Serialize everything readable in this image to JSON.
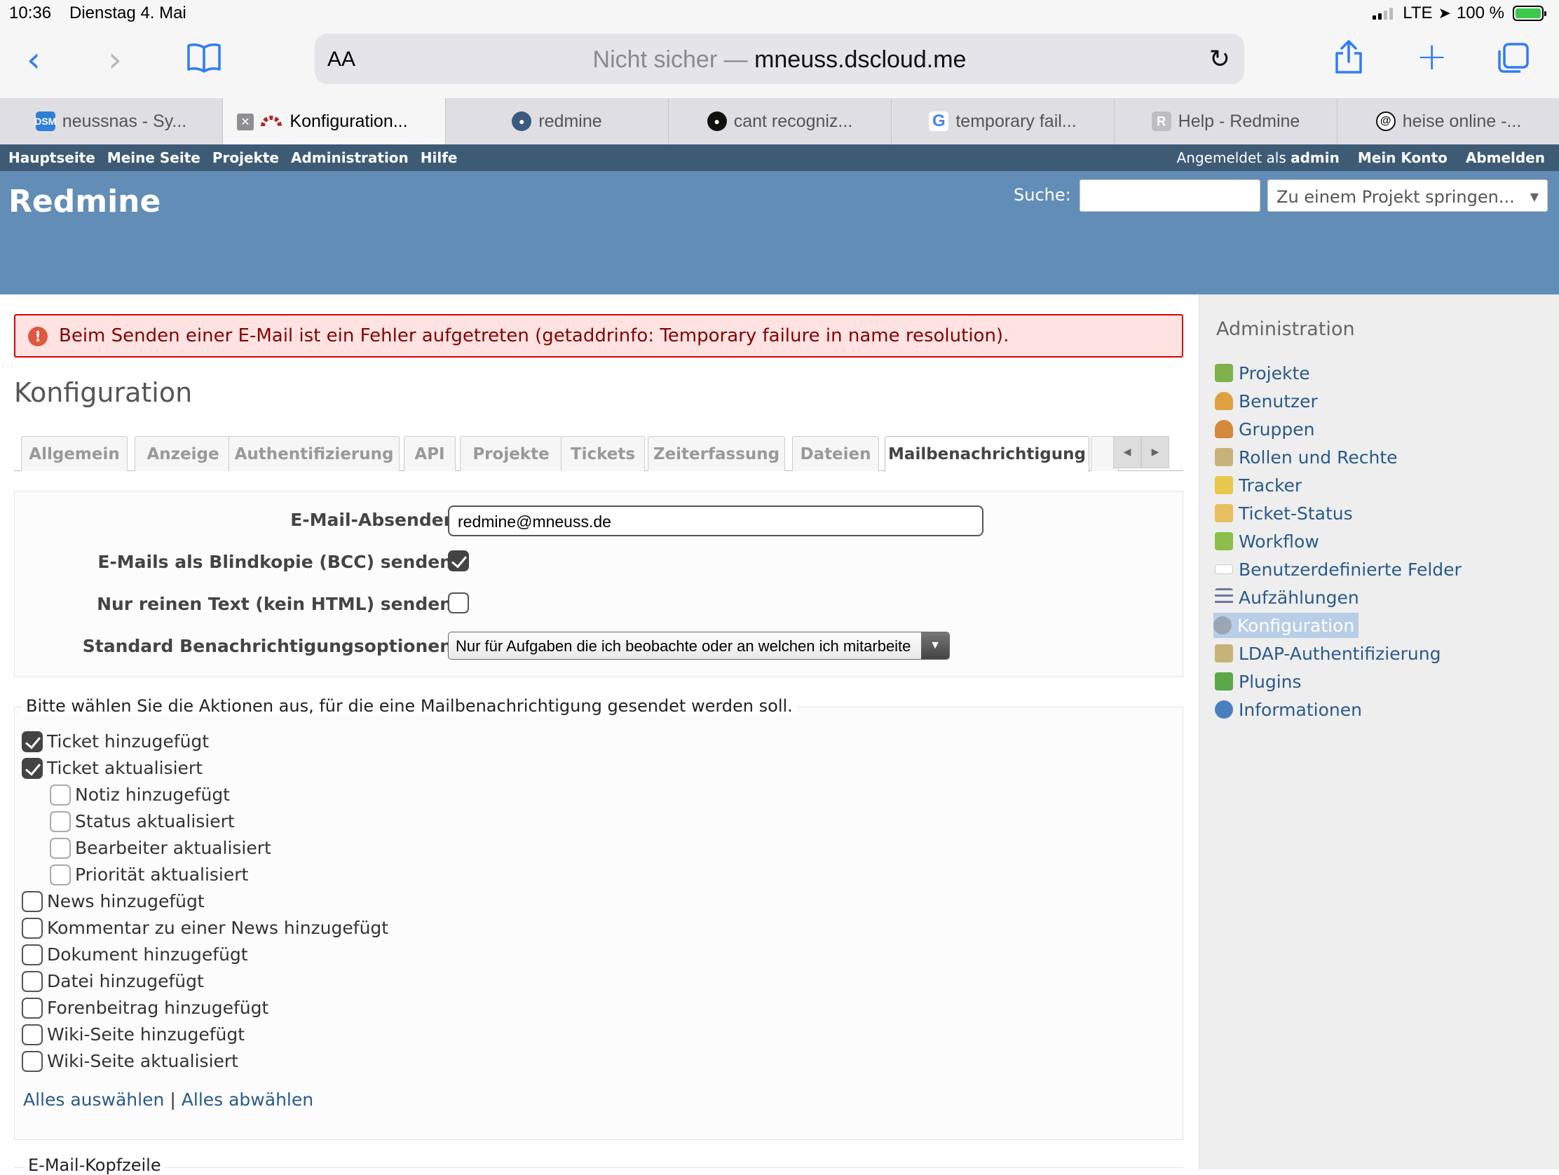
{
  "status": {
    "time": "10:36",
    "date": "Dienstag 4. Mai",
    "network": "LTE",
    "battery": "100 %"
  },
  "safari": {
    "aa": "AA",
    "not_secure": "Nicht sicher —",
    "host": "mneuss.dscloud.me",
    "tabs": [
      {
        "label": "neussnas - Sy...",
        "icon": "dsm-icon",
        "fav_text": "DSM",
        "fav_color": "#2f7fd6"
      },
      {
        "label": "Konfiguration...",
        "icon": "redmine-icon",
        "active": true
      },
      {
        "label": "redmine",
        "icon": "docker-icon"
      },
      {
        "label": "cant recogniz...",
        "icon": "github-icon"
      },
      {
        "label": "temporary fail...",
        "icon": "google-icon"
      },
      {
        "label": "Help - Redmine",
        "icon": "r-letter-icon",
        "fav_text": "R",
        "fav_color": "#bdbdc2"
      },
      {
        "label": "heise online -...",
        "icon": "heise-icon"
      }
    ]
  },
  "topmenu": {
    "items": [
      "Hauptseite",
      "Meine Seite",
      "Projekte",
      "Administration",
      "Hilfe"
    ],
    "logged_prefix": "Angemeldet als",
    "user": "admin",
    "account": "Mein Konto",
    "logout": "Abmelden"
  },
  "header": {
    "title": "Redmine",
    "search_label": "Suche:",
    "jump_placeholder": "Zu einem Projekt springen..."
  },
  "flash": {
    "message": "Beim Senden einer E-Mail ist ein Fehler aufgetreten (getaddrinfo: Temporary failure in name resolution)."
  },
  "page_title": "Konfiguration",
  "config_tabs": [
    "Allgemein",
    "Anzeige",
    "Authentifizierung",
    "API",
    "Projekte",
    "Tickets",
    "Zeiterfassung",
    "Dateien",
    "Mailbenachrichtigung"
  ],
  "selected_tab": "Mailbenachrichtigung",
  "mail_settings": {
    "sender_label": "E-Mail-Absender",
    "sender_value": "redmine@mneuss.de",
    "bcc_label": "E-Mails als Blindkopie (BCC) senden",
    "bcc_checked": true,
    "plain_label": "Nur reinen Text (kein HTML) senden",
    "plain_checked": false,
    "default_label": "Standard Benachrichtigungsoptionen",
    "default_value": "Nur für Aufgaben die ich beobachte oder an welchen ich mitarbeite"
  },
  "actions": {
    "legend": "Bitte wählen Sie die Aktionen aus, für die eine Mailbenachrichtigung gesendet werden soll.",
    "items": [
      {
        "label": "Ticket hinzugefügt",
        "checked": true,
        "indent": false
      },
      {
        "label": "Ticket aktualisiert",
        "checked": true,
        "indent": false
      },
      {
        "label": "Notiz hinzugefügt",
        "checked": false,
        "indent": true
      },
      {
        "label": "Status aktualisiert",
        "checked": false,
        "indent": true
      },
      {
        "label": "Bearbeiter aktualisiert",
        "checked": false,
        "indent": true
      },
      {
        "label": "Priorität aktualisiert",
        "checked": false,
        "indent": true
      },
      {
        "label": "News hinzugefügt",
        "checked": false,
        "indent": false
      },
      {
        "label": "Kommentar zu einer News hinzugefügt",
        "checked": false,
        "indent": false
      },
      {
        "label": "Dokument hinzugefügt",
        "checked": false,
        "indent": false
      },
      {
        "label": "Datei hinzugefügt",
        "checked": false,
        "indent": false
      },
      {
        "label": "Forenbeitrag hinzugefügt",
        "checked": false,
        "indent": false
      },
      {
        "label": "Wiki-Seite hinzugefügt",
        "checked": false,
        "indent": false
      },
      {
        "label": "Wiki-Seite aktualisiert",
        "checked": false,
        "indent": false
      }
    ],
    "select_all": "Alles auswählen",
    "separator": "|",
    "deselect_all": "Alles abwählen"
  },
  "next_section": "E-Mail-Kopfzeile",
  "sidebar": {
    "title": "Administration",
    "items": [
      {
        "label": "Projekte",
        "icon": "projects-icon",
        "color": "#7fb24a"
      },
      {
        "label": "Benutzer",
        "icon": "user-icon",
        "color": "#e0a040"
      },
      {
        "label": "Gruppen",
        "icon": "group-icon",
        "color": "#d48a3a"
      },
      {
        "label": "Rollen und Rechte",
        "icon": "roles-icon",
        "color": "#c9b27a"
      },
      {
        "label": "Tracker",
        "icon": "tracker-icon",
        "color": "#e8c84a"
      },
      {
        "label": "Ticket-Status",
        "icon": "ticket-status-icon",
        "color": "#e8c060"
      },
      {
        "label": "Workflow",
        "icon": "workflow-icon",
        "color": "#8bbf4a"
      },
      {
        "label": "Benutzerdefinierte Felder",
        "icon": "custom-fields-icon",
        "color": "#ffffff"
      },
      {
        "label": "Aufzählungen",
        "icon": "list-icon",
        "color": "#6a7aa0"
      },
      {
        "label": "Konfiguration",
        "icon": "gear-icon",
        "color": "#9aa6b4",
        "current": true
      },
      {
        "label": "LDAP-Authentifizierung",
        "icon": "ldap-icon",
        "color": "#c9b27a"
      },
      {
        "label": "Plugins",
        "icon": "plugin-icon",
        "color": "#5aa84a"
      },
      {
        "label": "Informationen",
        "icon": "info-icon",
        "color": "#4a80c0"
      }
    ]
  },
  "colors": {
    "topmenu": "#3e5b76",
    "header": "#628db6",
    "flash_bg": "#ffe3e3",
    "link": "#2a5a8a",
    "ios_blue": "#2f7cf6"
  }
}
